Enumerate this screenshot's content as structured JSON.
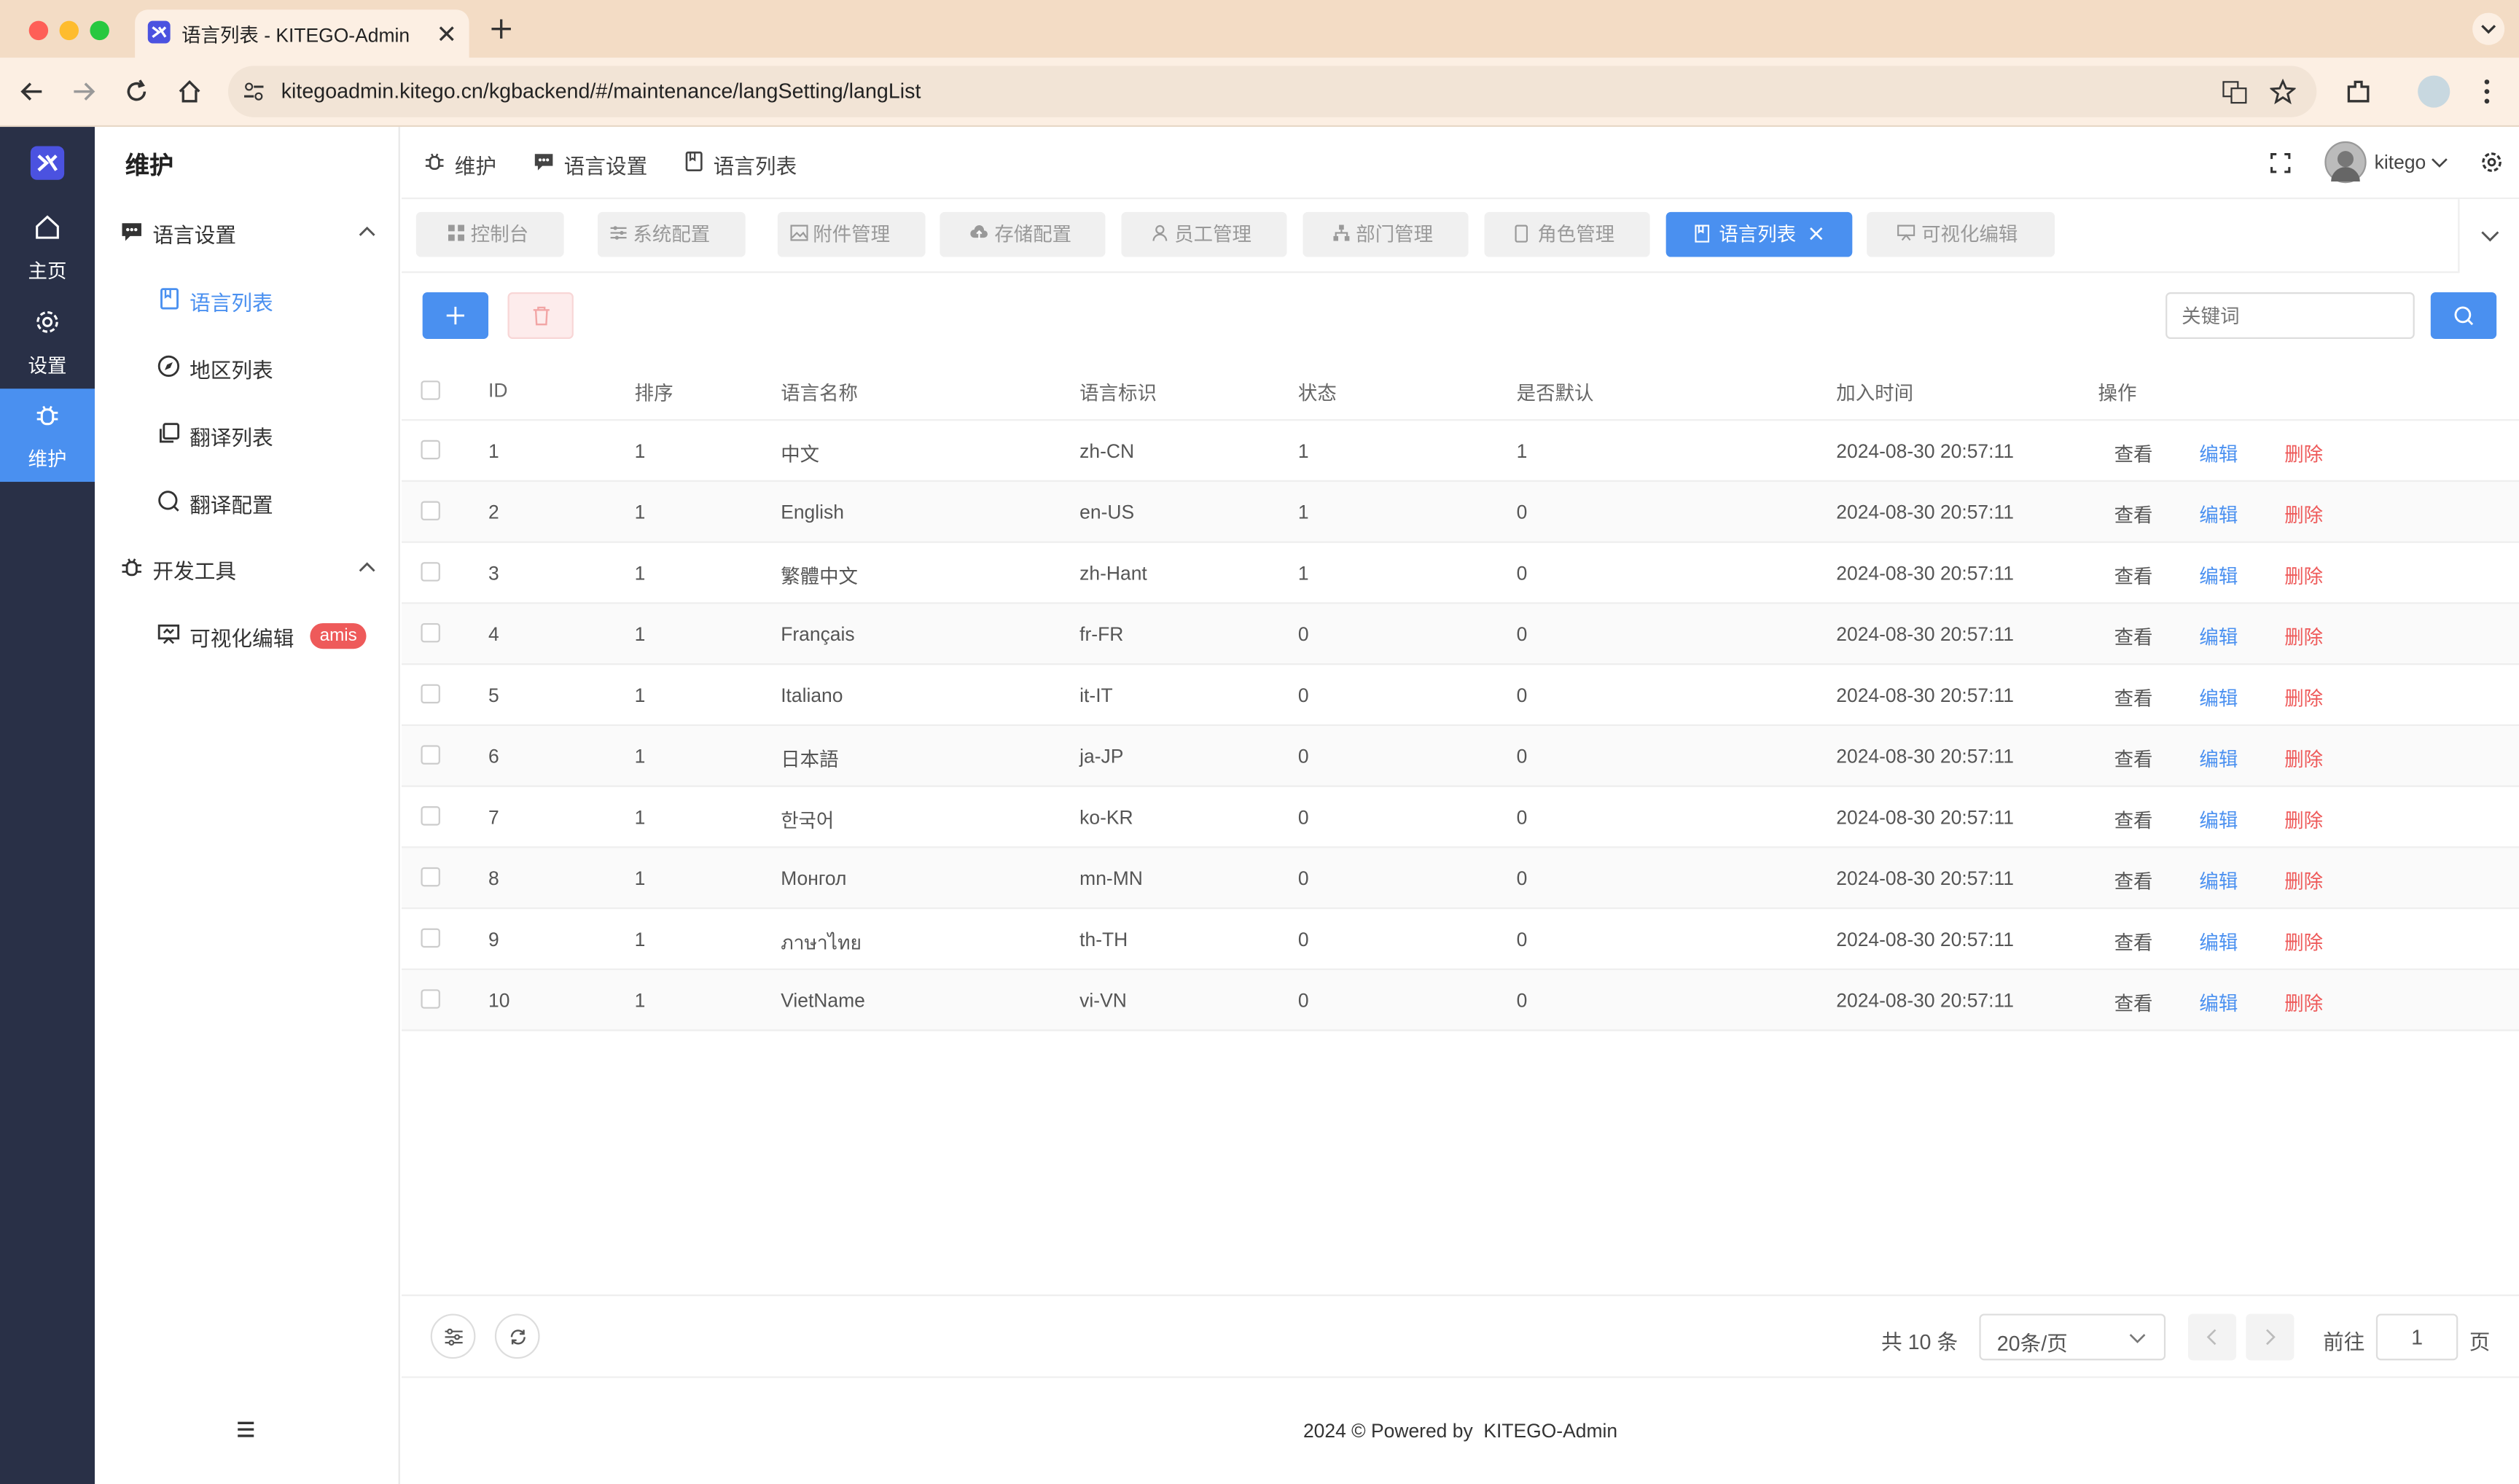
{
  "browser": {
    "tab_title": "语言列表 - KITEGO-Admin",
    "url": "kitegoadmin.kitego.cn/kgbackend/#/maintenance/langSetting/langList"
  },
  "rail": {
    "items": [
      {
        "label": "主页",
        "icon": "home-icon"
      },
      {
        "label": "设置",
        "icon": "gear-icon"
      },
      {
        "label": "维护",
        "icon": "bug-icon",
        "active": true
      }
    ]
  },
  "menu": {
    "title": "维护",
    "groups": [
      {
        "label": "语言设置",
        "items": [
          "语言列表",
          "地区列表",
          "翻译列表",
          "翻译配置"
        ]
      },
      {
        "label": "开发工具",
        "items": [
          "可视化编辑"
        ]
      }
    ],
    "badge": "amis"
  },
  "header": {
    "breadcrumb": [
      "维护",
      "语言设置",
      "语言列表"
    ],
    "user": "kitego"
  },
  "tabs": [
    "控制台",
    "系统配置",
    "附件管理",
    "存储配置",
    "员工管理",
    "部门管理",
    "角色管理",
    "语言列表",
    "可视化编辑"
  ],
  "active_tab": "语言列表",
  "search": {
    "placeholder": "关键词"
  },
  "table": {
    "columns": [
      "ID",
      "排序",
      "语言名称",
      "语言标识",
      "状态",
      "是否默认",
      "加入时间",
      "操作"
    ],
    "actions": {
      "view": "查看",
      "edit": "编辑",
      "delete": "删除"
    },
    "rows": [
      [
        "1",
        "1",
        "中文",
        "zh-CN",
        "1",
        "1",
        "2024-08-30 20:57:11"
      ],
      [
        "2",
        "1",
        "English",
        "en-US",
        "1",
        "0",
        "2024-08-30 20:57:11"
      ],
      [
        "3",
        "1",
        "繁體中文",
        "zh-Hant",
        "1",
        "0",
        "2024-08-30 20:57:11"
      ],
      [
        "4",
        "1",
        "Français",
        "fr-FR",
        "0",
        "0",
        "2024-08-30 20:57:11"
      ],
      [
        "5",
        "1",
        "Italiano",
        "it-IT",
        "0",
        "0",
        "2024-08-30 20:57:11"
      ],
      [
        "6",
        "1",
        "日本語",
        "ja-JP",
        "0",
        "0",
        "2024-08-30 20:57:11"
      ],
      [
        "7",
        "1",
        "한국어",
        "ko-KR",
        "0",
        "0",
        "2024-08-30 20:57:11"
      ],
      [
        "8",
        "1",
        "Монгол",
        "mn-MN",
        "0",
        "0",
        "2024-08-30 20:57:11"
      ],
      [
        "9",
        "1",
        "ภาษาไทย",
        "th-TH",
        "0",
        "0",
        "2024-08-30 20:57:11"
      ],
      [
        "10",
        "1",
        "VietName",
        "vi-VN",
        "0",
        "0",
        "2024-08-30 20:57:11"
      ]
    ]
  },
  "pagination": {
    "total_text": "共 10 条",
    "per_page": "20条/页",
    "goto_label": "前往",
    "page": "1",
    "page_suffix": "页"
  },
  "footer": {
    "text": "2024 © Powered by  KITEGO-Admin"
  },
  "colors": {
    "accent": "#4a90f0",
    "rail": "#293047",
    "danger": "#ee5a5a",
    "browser_chrome": "#f3dcc5"
  }
}
